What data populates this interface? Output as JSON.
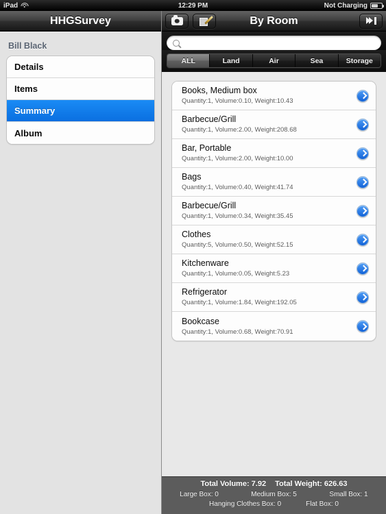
{
  "statusbar": {
    "device": "iPad",
    "wifi_icon": "wifi-icon",
    "time": "12:29 PM",
    "power": "Not Charging",
    "battery_icon": "battery-icon"
  },
  "sidebar": {
    "nav_title": "HHGSurvey",
    "section_header": "Bill Black",
    "items": [
      {
        "label": "Details",
        "selected": false
      },
      {
        "label": "Items",
        "selected": false
      },
      {
        "label": "Summary",
        "selected": true
      },
      {
        "label": "Album",
        "selected": false
      }
    ],
    "selected_color": "#0a6fe0"
  },
  "detail": {
    "nav_title": "By Room",
    "toolbar_left": [
      {
        "name": "camera-button",
        "icon": "camera-icon"
      },
      {
        "name": "edit-button",
        "icon": "pencil-square-icon"
      }
    ],
    "toolbar_right": {
      "name": "next-button",
      "icon": "skip-forward-icon"
    },
    "search": {
      "value": "",
      "placeholder": "",
      "icon": "search-icon"
    },
    "segments": [
      {
        "label": "ALL",
        "active": true
      },
      {
        "label": "Land",
        "active": false
      },
      {
        "label": "Air",
        "active": false
      },
      {
        "label": "Sea",
        "active": false
      },
      {
        "label": "Storage",
        "active": false
      }
    ],
    "items": [
      {
        "name": "Books, Medium box",
        "meta": "Quantity:1, Volume:0.10, Weight:10.43"
      },
      {
        "name": "Barbecue/Grill",
        "meta": "Quantity:1, Volume:2.00, Weight:208.68"
      },
      {
        "name": "Bar, Portable",
        "meta": "Quantity:1, Volume:2.00, Weight:10.00"
      },
      {
        "name": "Bags",
        "meta": "Quantity:1, Volume:0.40, Weight:41.74"
      },
      {
        "name": "Barbecue/Grill",
        "meta": "Quantity:1, Volume:0.34, Weight:35.45"
      },
      {
        "name": "Clothes",
        "meta": "Quantity:5, Volume:0.50, Weight:52.15"
      },
      {
        "name": "Kitchenware",
        "meta": "Quantity:1, Volume:0.05, Weight:5.23"
      },
      {
        "name": "Refrigerator",
        "meta": "Quantity:1, Volume:1.84, Weight:192.05"
      },
      {
        "name": "Bookcase",
        "meta": "Quantity:1, Volume:0.68, Weight:70.91"
      }
    ],
    "summary": {
      "total_volume": "Total Volume: 7.92",
      "total_weight": "Total Weight: 626.63",
      "large_box": "Large Box: 0",
      "medium_box": "Medium Box: 5",
      "small_box": "Small Box: 1",
      "hanging_clothes_box": "Hanging Clothes Box: 0",
      "flat_box": "Flat Box: 0"
    }
  }
}
